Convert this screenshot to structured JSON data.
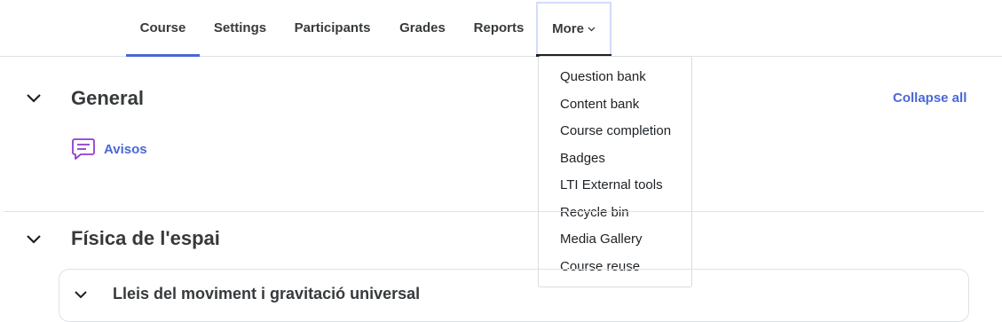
{
  "nav": {
    "tabs": [
      {
        "label": "Course"
      },
      {
        "label": "Settings"
      },
      {
        "label": "Participants"
      },
      {
        "label": "Grades"
      },
      {
        "label": "Reports"
      },
      {
        "label": "More"
      }
    ]
  },
  "more_menu": {
    "items": [
      {
        "label": "Question bank"
      },
      {
        "label": "Content bank"
      },
      {
        "label": "Course completion"
      },
      {
        "label": "Badges"
      },
      {
        "label": "LTI External tools"
      },
      {
        "label": "Recycle bin"
      },
      {
        "label": "Media Gallery"
      },
      {
        "label": "Course reuse"
      }
    ]
  },
  "course": {
    "collapse_all": "Collapse all",
    "sections": [
      {
        "title": "General",
        "activities": [
          {
            "label": "Avisos",
            "icon": "forum-icon"
          }
        ]
      },
      {
        "title": "Física de l'espai",
        "subsections": [
          {
            "title": "Lleis del moviment i gravitació universal"
          }
        ]
      }
    ]
  },
  "colors": {
    "accent": "#4a67d6",
    "text": "#373a3c",
    "border": "#dee2e6"
  }
}
